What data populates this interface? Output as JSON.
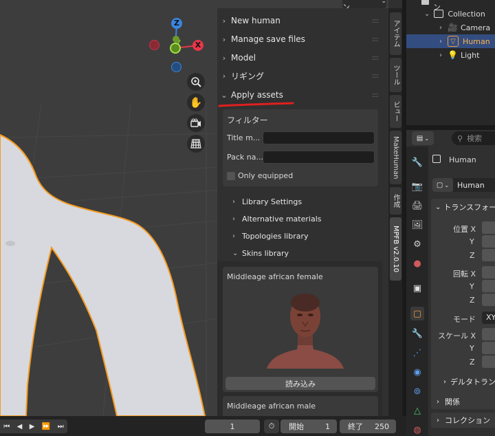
{
  "topbar": {
    "options_label": "オプション"
  },
  "npanel": {
    "headers": [
      {
        "label": "New human",
        "expanded": false
      },
      {
        "label": "Manage save files",
        "expanded": false
      },
      {
        "label": "Model",
        "expanded": false
      },
      {
        "label": "リギング",
        "expanded": false
      },
      {
        "label": "Apply assets",
        "expanded": true
      }
    ],
    "filter": {
      "title": "フィルター",
      "title_match_label": "Title m...",
      "title_match_value": "",
      "pack_name_label": "Pack na...",
      "pack_name_value": "",
      "only_equipped_label": "Only equipped",
      "only_equipped": false
    },
    "subsections": [
      {
        "label": "Library Settings",
        "expanded": false
      },
      {
        "label": "Alternative materials",
        "expanded": false
      },
      {
        "label": "Topologies library",
        "expanded": false
      },
      {
        "label": "Skins library",
        "expanded": true
      }
    ],
    "skins": [
      {
        "name": "Middleage african female",
        "load_label": "読み込み"
      },
      {
        "name": "Middleage african male"
      }
    ]
  },
  "tabs": [
    {
      "label": "アイテム",
      "active": false
    },
    {
      "label": "ツール",
      "active": false
    },
    {
      "label": "ビュー",
      "active": false
    },
    {
      "label": "MakeHuman",
      "active": false
    },
    {
      "label": "作成",
      "active": false
    },
    {
      "label": "MPFB v2.0.10",
      "active": true
    }
  ],
  "gizmo": {
    "z_label": "Z",
    "x_label": "X",
    "colors": {
      "x": "#e8364a",
      "y": "#7bbf23",
      "z": "#3a86e0"
    }
  },
  "outliner": {
    "scene_collection": "シーンコレクション",
    "collection": "Collection",
    "items": [
      {
        "label": "Camera",
        "icon": "camera-icon",
        "selected": false
      },
      {
        "label": "Human",
        "icon": "mesh-icon",
        "selected": true
      },
      {
        "label": "Light",
        "icon": "light-icon",
        "selected": false
      }
    ]
  },
  "properties": {
    "search_placeholder": "検索",
    "object_name": "Human",
    "data_name": "Human",
    "transform_label": "トランスフォーム",
    "location_label": "位置 X",
    "rotation_label": "回転 X",
    "mode_label": "モード",
    "mode_value": "XY",
    "scale_label": "スケール X",
    "axis_y": "Y",
    "axis_z": "Z",
    "delta_transform_label": "デルタトランスフォーム",
    "relations_label": "関係",
    "collections_label": "コレクション"
  },
  "timeline": {
    "current_frame": "1",
    "start_label": "開始",
    "start_value": "1",
    "end_label": "終了",
    "end_value": "250"
  }
}
